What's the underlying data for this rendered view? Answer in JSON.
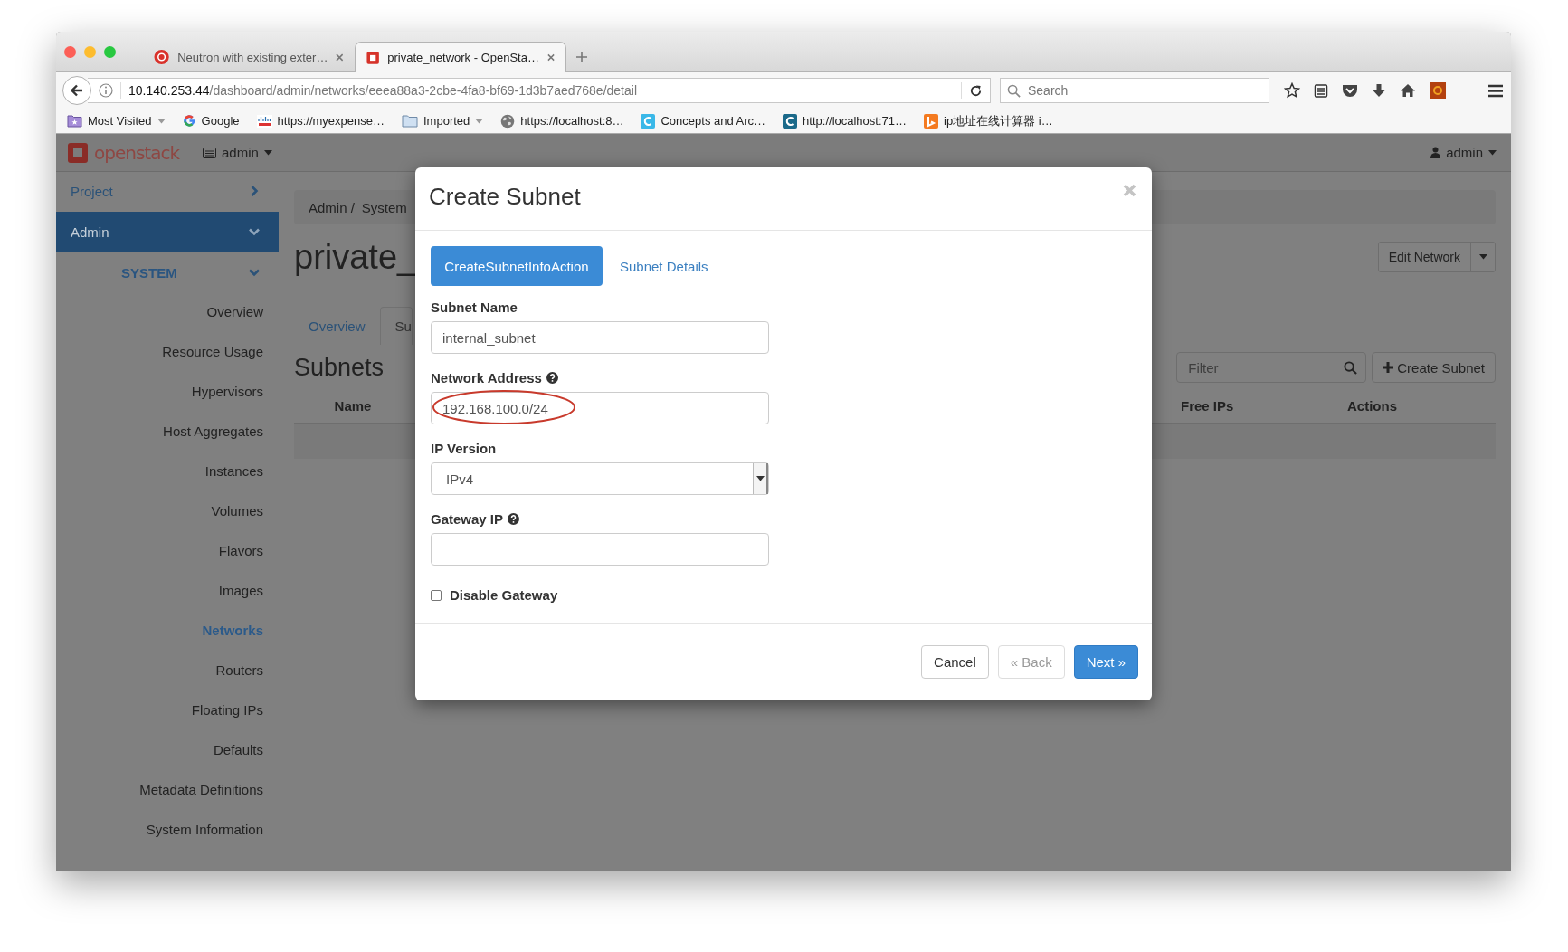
{
  "browser": {
    "tabs": [
      {
        "title": "Neutron with existing exter…",
        "kind": "rdo",
        "selected": false
      },
      {
        "title": "private_network - OpenSta…",
        "kind": "openstack",
        "selected": true
      }
    ],
    "address": {
      "host": "10.140.253.44",
      "path": "/dashboard/admin/networks/eeea88a3-2cbe-4fa8-bf69-1d3b7aed768e/detail"
    },
    "search": {
      "placeholder": "Search"
    },
    "bookmarks": [
      {
        "label": "Most Visited",
        "kind": "star-folder",
        "dropdown": true
      },
      {
        "label": "Google",
        "kind": "google",
        "dropdown": false
      },
      {
        "label": "https://myexpense…",
        "kind": "cisco",
        "dropdown": false
      },
      {
        "label": "Imported",
        "kind": "folder",
        "dropdown": true
      },
      {
        "label": "https://localhost:8…",
        "kind": "globe",
        "dropdown": false
      },
      {
        "label": "Concepts and Arc…",
        "kind": "c-light",
        "dropdown": false
      },
      {
        "label": "http://localhost:71…",
        "kind": "c-dark",
        "dropdown": false
      },
      {
        "label": "ip地址在线计算器 i…",
        "kind": "b-orange",
        "dropdown": false
      }
    ]
  },
  "header": {
    "logo": "openstack",
    "project": "admin",
    "user": "admin"
  },
  "sidebar": {
    "panels": [
      {
        "label": "Project",
        "selected": false,
        "expanded": false
      },
      {
        "label": "Admin",
        "selected": true,
        "expanded": true
      }
    ],
    "section": {
      "label": "SYSTEM",
      "expanded": true
    },
    "items": [
      {
        "label": "Overview",
        "selected": false
      },
      {
        "label": "Resource Usage",
        "selected": false
      },
      {
        "label": "Hypervisors",
        "selected": false
      },
      {
        "label": "Host Aggregates",
        "selected": false
      },
      {
        "label": "Instances",
        "selected": false
      },
      {
        "label": "Volumes",
        "selected": false
      },
      {
        "label": "Flavors",
        "selected": false
      },
      {
        "label": "Images",
        "selected": false
      },
      {
        "label": "Networks",
        "selected": true
      },
      {
        "label": "Routers",
        "selected": false
      },
      {
        "label": "Floating IPs",
        "selected": false
      },
      {
        "label": "Defaults",
        "selected": false
      },
      {
        "label": "Metadata Definitions",
        "selected": false
      },
      {
        "label": "System Information",
        "selected": false
      }
    ]
  },
  "content": {
    "breadcrumbs": [
      "Admin /",
      "System"
    ],
    "title": "private_",
    "edit_button": "Edit Network",
    "tabs": [
      {
        "label": "Overview",
        "selected": false
      },
      {
        "label": "Su",
        "selected": true
      }
    ],
    "section_title": "Subnets",
    "filter": {
      "placeholder": "Filter"
    },
    "create_button": "Create Subnet",
    "columns": [
      "Name",
      "Free IPs",
      "Actions"
    ]
  },
  "modal": {
    "title": "Create Subnet",
    "tabs": [
      {
        "label": "CreateSubnetInfoAction",
        "selected": true
      },
      {
        "label": "Subnet Details",
        "selected": false
      }
    ],
    "fields": [
      {
        "kind": "text",
        "label": "Subnet Name",
        "help": false,
        "value": "internal_subnet",
        "annotated": false
      },
      {
        "kind": "text",
        "label": "Network Address",
        "help": true,
        "value": "192.168.100.0/24",
        "annotated": true
      },
      {
        "kind": "select",
        "label": "IP Version",
        "help": false,
        "value": "IPv4"
      },
      {
        "kind": "text",
        "label": "Gateway IP",
        "help": true,
        "annotated": false
      }
    ],
    "checkbox": {
      "label": "Disable Gateway",
      "checked": false
    },
    "buttons": [
      {
        "label": "Cancel",
        "kind": "default",
        "disabled": false
      },
      {
        "label": "« Back",
        "kind": "default",
        "disabled": true
      },
      {
        "label": "Next »",
        "kind": "primary",
        "disabled": false
      }
    ]
  }
}
